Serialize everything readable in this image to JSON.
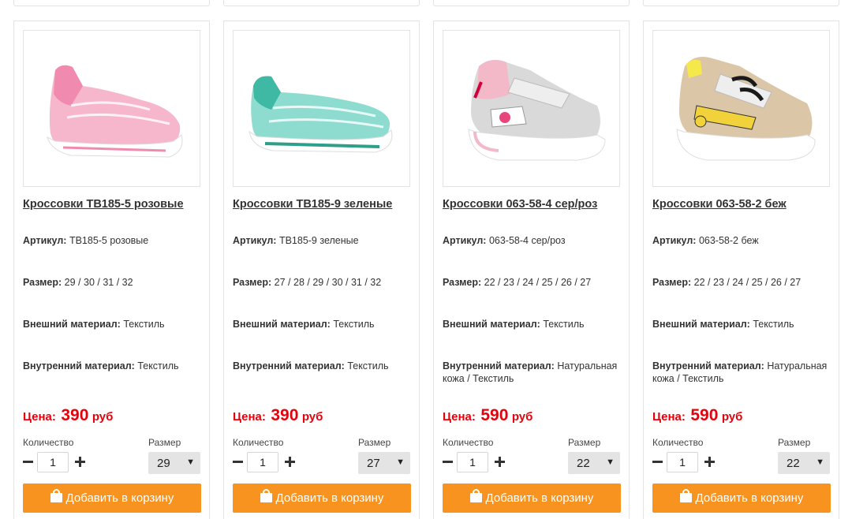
{
  "products": [
    {
      "title": "Кроссовки TB185-5 розовые",
      "article_label": "Артикул:",
      "article": "TB185-5 розовые",
      "size_label": "Размер:",
      "sizes": "29 / 30 / 31 / 32",
      "outer_label": "Внешний материал:",
      "outer": "Текстиль",
      "inner_label": "Внутренний материал:",
      "inner": "Текстиль",
      "price_label": "Цена:",
      "price": "390",
      "currency": "руб",
      "qty_label": "Количество",
      "qty": "1",
      "size_select_label": "Размер",
      "size_selected": "29",
      "add_label": "Добавить в корзину",
      "image_icon": "pink-woven-sneaker",
      "image_color": "#f3a2c0"
    },
    {
      "title": "Кроссовки TB185-9 зеленые",
      "article_label": "Артикул:",
      "article": "TB185-9 зеленые",
      "size_label": "Размер:",
      "sizes": "27 / 28 / 29 / 30 / 31 / 32",
      "outer_label": "Внешний материал:",
      "outer": "Текстиль",
      "inner_label": "Внутренний материал:",
      "inner": "Текстиль",
      "price_label": "Цена:",
      "price": "390",
      "currency": "руб",
      "qty_label": "Количество",
      "qty": "1",
      "size_select_label": "Размер",
      "size_selected": "27",
      "add_label": "Добавить в корзину",
      "image_icon": "green-woven-sneaker",
      "image_color": "#5ec8b6"
    },
    {
      "title": "Кроссовки 063-58-4 сер/роз",
      "article_label": "Артикул:",
      "article": "063-58-4 сер/роз",
      "size_label": "Размер:",
      "sizes": "22 / 23 / 24 / 25 / 26 / 27",
      "outer_label": "Внешний материал:",
      "outer": "Текстиль",
      "inner_label": "Внутренний материал:",
      "inner": "Натуральная кожа / Текстиль",
      "price_label": "Цена:",
      "price": "590",
      "currency": "руб",
      "qty_label": "Количество",
      "qty": "1",
      "size_select_label": "Размер",
      "size_selected": "22",
      "add_label": "Добавить в корзину",
      "image_icon": "grey-pink-sneaker",
      "image_color": "#cfcfcf"
    },
    {
      "title": "Кроссовки 063-58-2 беж",
      "article_label": "Артикул:",
      "article": "063-58-2 беж",
      "size_label": "Размер:",
      "sizes": "22 / 23 / 24 / 25 / 26 / 27",
      "outer_label": "Внешний материал:",
      "outer": "Текстиль",
      "inner_label": "Внутренний материал:",
      "inner": "Натуральная кожа / Текстиль",
      "price_label": "Цена:",
      "price": "590",
      "currency": "руб",
      "qty_label": "Количество",
      "qty": "1",
      "size_select_label": "Размер",
      "size_selected": "22",
      "add_label": "Добавить в корзину",
      "image_icon": "beige-sneaker",
      "image_color": "#e2d1bb"
    }
  ],
  "colors": {
    "price": "#e8000b",
    "button": "#f7931e",
    "border": "#e3e3e3"
  }
}
